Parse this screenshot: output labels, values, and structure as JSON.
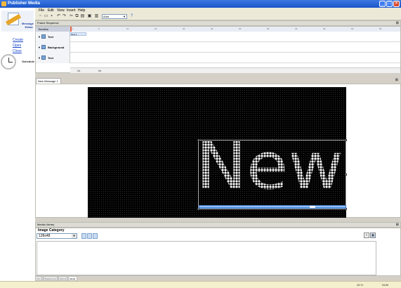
{
  "window": {
    "title": "Publisher Media",
    "minimize": "_",
    "maximize": "□",
    "close": "✕"
  },
  "sidebar": {
    "editor_label": "Message Editor",
    "links": [
      "Create",
      "Open",
      "Close"
    ],
    "schedule_label": "Schedule"
  },
  "menu": [
    "File",
    "Edit",
    "View",
    "Insert",
    "Help"
  ],
  "toolbar": {
    "speed_value": "Auto"
  },
  "frame_sequence": {
    "title": "Frame Sequence",
    "timeline_label": "Timeline",
    "ruler": [
      "1",
      "5",
      "10",
      "15",
      "20",
      "25",
      "30",
      "35",
      "40",
      "45",
      "50",
      "55"
    ],
    "layers": [
      {
        "name": "Text",
        "frame": "New 1"
      },
      {
        "name": "Background",
        "frame": ""
      },
      {
        "name": "Text",
        "frame": ""
      }
    ],
    "footer_a": "2s",
    "footer_b": "0s"
  },
  "editor": {
    "tab": "New Message 1",
    "led_text": "New"
  },
  "media": {
    "title": "Media Library",
    "category_label": "Image Category",
    "category_value": "128x48"
  },
  "bottom_tabs": [
    "Text",
    "Background",
    "Effects",
    "Media Library"
  ],
  "status": {
    "zoom": "45 %",
    "mode": "NUM"
  },
  "colors": {
    "titlebar": "#1a55c9",
    "canvas": "#000000",
    "led": "#ffffff",
    "link": "#1845c8"
  }
}
